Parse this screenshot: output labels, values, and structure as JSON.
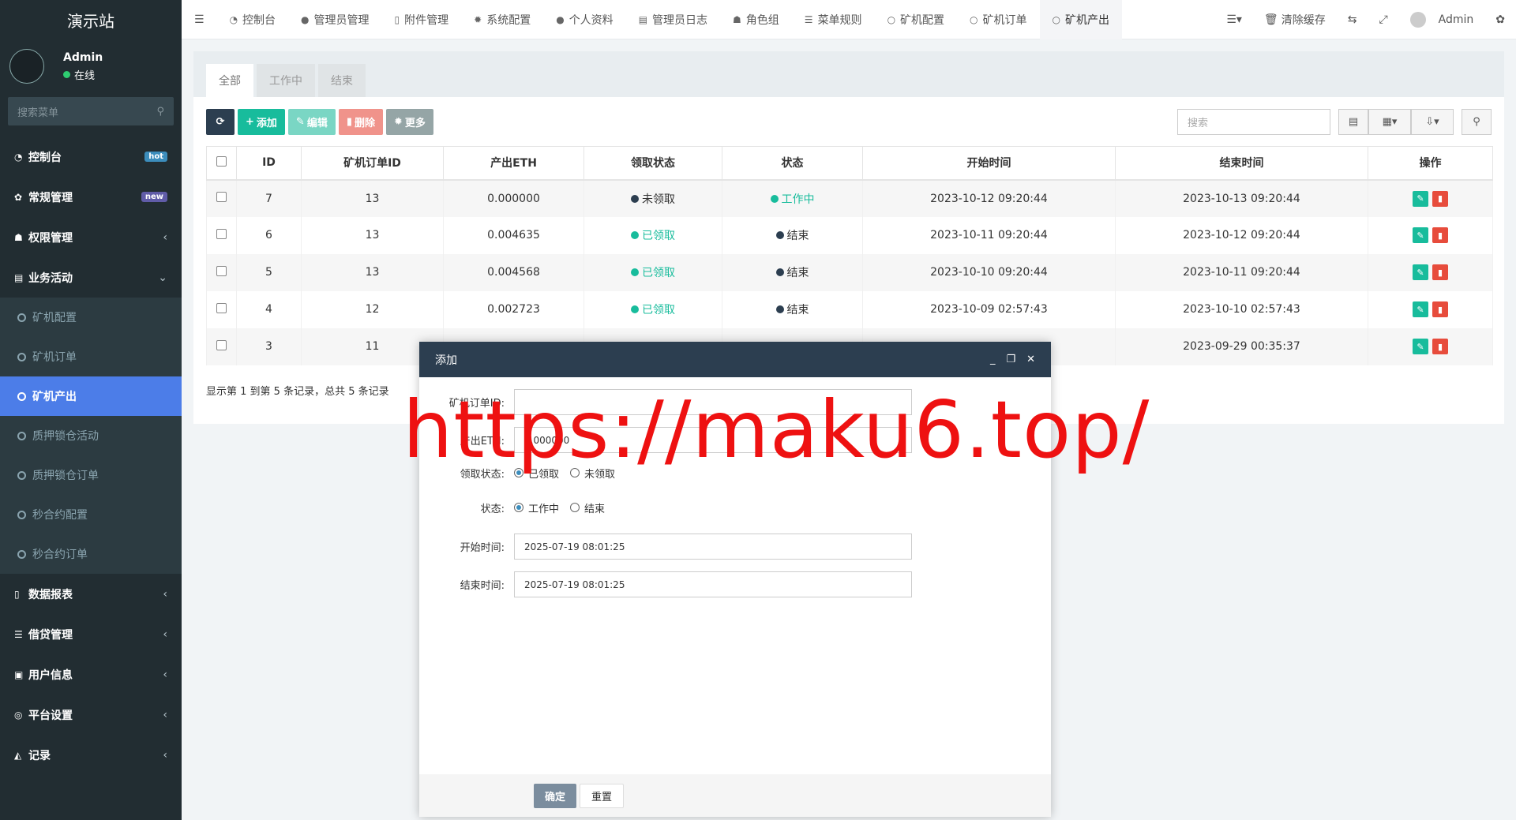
{
  "sidebar": {
    "logo": "演示站",
    "user": {
      "name": "Admin",
      "status": "在线"
    },
    "search_placeholder": "搜索菜单",
    "items": [
      {
        "icon": "dashboard-icon",
        "label": "控制台",
        "badge": "hot"
      },
      {
        "icon": "cogs-icon",
        "label": "常规管理",
        "badge": "new"
      },
      {
        "icon": "group-icon",
        "label": "权限管理",
        "caret": "‹"
      },
      {
        "icon": "list-alt-icon",
        "label": "业务活动",
        "caret": "⌄"
      }
    ],
    "submenu": [
      {
        "label": "矿机配置"
      },
      {
        "label": "矿机订单"
      },
      {
        "label": "矿机产出",
        "active": true
      },
      {
        "label": "质押锁仓活动"
      },
      {
        "label": "质押锁仓订单"
      },
      {
        "label": "秒合约配置"
      },
      {
        "label": "秒合约订单"
      }
    ],
    "items_after": [
      {
        "icon": "file-icon",
        "label": "数据报表",
        "caret": "‹"
      },
      {
        "icon": "list-icon",
        "label": "借贷管理",
        "caret": "‹"
      },
      {
        "icon": "user-card-icon",
        "label": "用户信息",
        "caret": "‹"
      },
      {
        "icon": "circle-dot-icon",
        "label": "平台设置",
        "caret": "‹"
      },
      {
        "icon": "area-chart-icon",
        "label": "记录",
        "caret": "‹"
      }
    ]
  },
  "topbar": {
    "tabs": [
      {
        "icon": "dashboard-icon",
        "label": "控制台"
      },
      {
        "icon": "user-icon",
        "label": "管理员管理"
      },
      {
        "icon": "file-image-icon",
        "label": "附件管理"
      },
      {
        "icon": "cog-icon",
        "label": "系统配置"
      },
      {
        "icon": "user-icon",
        "label": "个人资料"
      },
      {
        "icon": "list-alt-icon",
        "label": "管理员日志"
      },
      {
        "icon": "group-icon",
        "label": "角色组"
      },
      {
        "icon": "bars-icon",
        "label": "菜单规则"
      },
      {
        "icon": "circle-icon",
        "label": "矿机配置"
      },
      {
        "icon": "circle-icon",
        "label": "矿机订单"
      },
      {
        "icon": "circle-icon",
        "label": "矿机产出",
        "active": true
      }
    ],
    "clear_cache": "清除缓存",
    "admin": "Admin"
  },
  "panel": {
    "tabs": [
      "全部",
      "工作中",
      "结束"
    ],
    "toolbar": {
      "add": "添加",
      "edit": "编辑",
      "delete": "删除",
      "more": "更多",
      "search_placeholder": "搜索"
    },
    "table": {
      "headers": [
        "ID",
        "矿机订单ID",
        "产出ETH",
        "领取状态",
        "状态",
        "开始时间",
        "结束时间",
        "操作"
      ],
      "rows": [
        {
          "id": "7",
          "order_id": "13",
          "eth": "0.000000",
          "claim": "未领取",
          "claim_color": "dark",
          "state": "工作中",
          "state_color": "green",
          "start": "2023-10-12 09:20:44",
          "end": "2023-10-13 09:20:44"
        },
        {
          "id": "6",
          "order_id": "13",
          "eth": "0.004635",
          "claim": "已领取",
          "claim_color": "green",
          "state": "结束",
          "state_color": "dark",
          "start": "2023-10-11 09:20:44",
          "end": "2023-10-12 09:20:44"
        },
        {
          "id": "5",
          "order_id": "13",
          "eth": "0.004568",
          "claim": "已领取",
          "claim_color": "green",
          "state": "结束",
          "state_color": "dark",
          "start": "2023-10-10 09:20:44",
          "end": "2023-10-11 09:20:44"
        },
        {
          "id": "4",
          "order_id": "12",
          "eth": "0.002723",
          "claim": "已领取",
          "claim_color": "green",
          "state": "结束",
          "state_color": "dark",
          "start": "2023-10-09 02:57:43",
          "end": "2023-10-10 02:57:43"
        },
        {
          "id": "3",
          "order_id": "11",
          "eth": "",
          "claim": "",
          "claim_color": "",
          "state": "",
          "state_color": "",
          "start": "",
          "end": "2023-09-29 00:35:37"
        }
      ]
    },
    "summary": "显示第 1 到第 5 条记录，总共 5 条记录"
  },
  "modal": {
    "title": "添加",
    "fields": {
      "order_id_label": "矿机订单ID:",
      "eth_label": "产出ETH:",
      "eth_value": "0.000000",
      "claim_label": "领取状态:",
      "claim_options": [
        "已领取",
        "未领取"
      ],
      "state_label": "状态:",
      "state_options": [
        "工作中",
        "结束"
      ],
      "start_label": "开始时间:",
      "start_value": "2025-07-19 08:01:25",
      "end_label": "结束时间:",
      "end_value": "2025-07-19 08:01:25"
    },
    "ok": "确定",
    "reset": "重置"
  },
  "watermark": "https://maku6.top/",
  "colors": {
    "sidebar_bg": "#222d32",
    "active_blue": "#4c7de8",
    "green": "#18bc9c",
    "red": "#e74c3c",
    "header_dark": "#2c3e50",
    "watermark": "#ee1111"
  }
}
